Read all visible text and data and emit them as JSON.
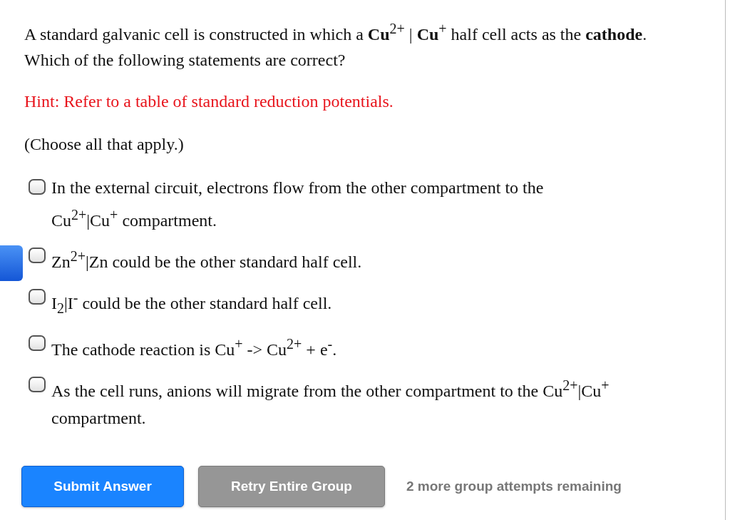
{
  "question": "A standard galvanic cell is constructed in which a **Cu**$^{2+}$ | **Cu**$^{+}$ half cell acts as the **cathode**. Which of the following statements are correct?",
  "hint": "Hint: Refer to a table of standard reduction potentials.",
  "instruction": "(Choose all that apply.)",
  "options": [
    {
      "text": "In the external circuit, electrons flow from the other compartment to the Cu$^{2+}$|Cu$^{+}$ compartment.",
      "checked": false
    },
    {
      "text": "Zn$^{2+}$|Zn could be the other standard half cell.",
      "checked": false
    },
    {
      "text": "I$_{2}$|I$^{-}$ could be the other standard half cell.",
      "checked": false
    },
    {
      "text": "The cathode reaction is Cu$^{+}$ -> Cu$^{2+}$ + e$^{-}$.",
      "checked": false
    },
    {
      "text": "As the cell runs, anions will migrate from the other compartment to the Cu$^{2+}$|Cu$^{+}$ compartment.",
      "checked": false
    }
  ],
  "buttons": [
    {
      "label": "Submit Answer",
      "kind": "primary"
    },
    {
      "label": "Retry Entire Group",
      "kind": "secondary"
    }
  ],
  "attempts": "2 more group attempts remaining"
}
